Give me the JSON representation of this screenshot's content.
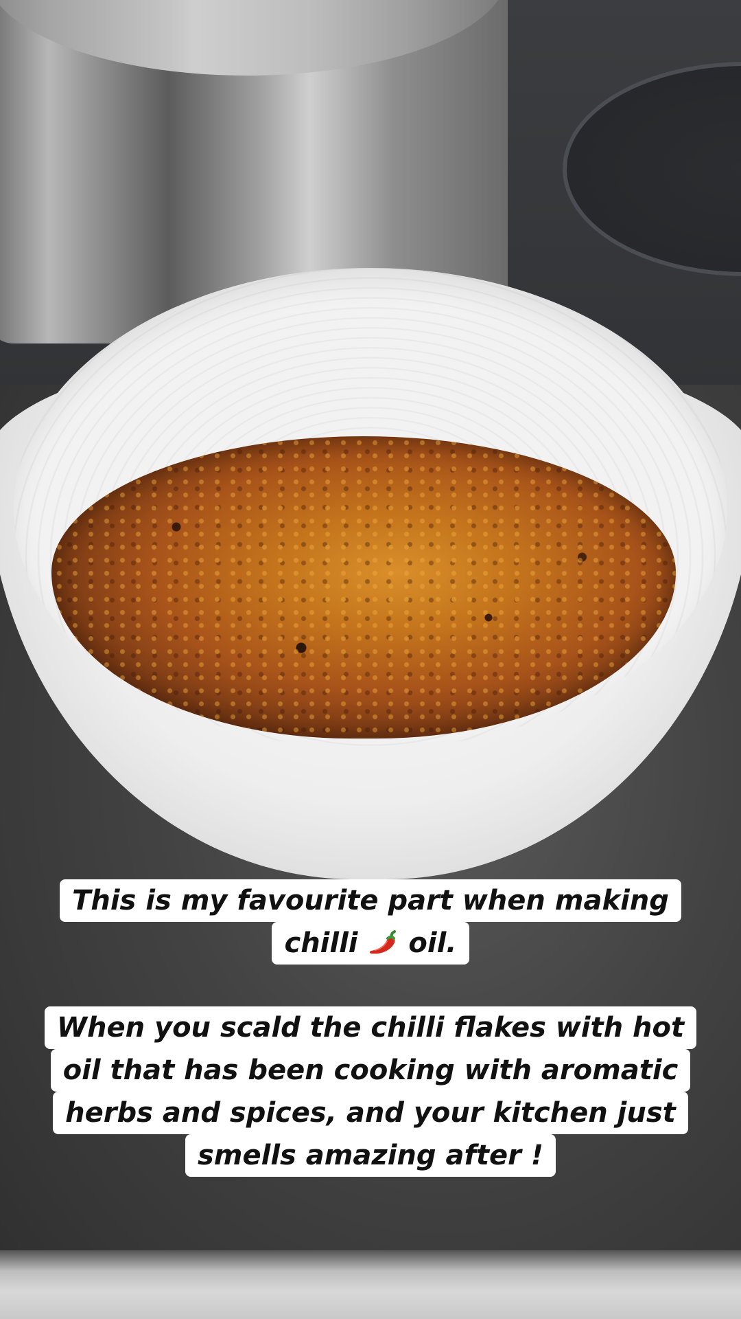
{
  "caption": {
    "line1_row1": "This is my favourite part when making",
    "line1_row2_before": "chilli",
    "line1_row2_after": "oil.",
    "line2_rows": [
      "When you scald the chilli flakes with hot",
      "oil that has been cooking with aromatic",
      "herbs and spices, and your kitchen just",
      "smells amazing after !"
    ]
  },
  "icons": {
    "pepper": "hot-pepper-emoji"
  },
  "colors": {
    "caption_bg": "#ffffff",
    "caption_text": "#111111",
    "chilli_red": "#d42a1e"
  }
}
